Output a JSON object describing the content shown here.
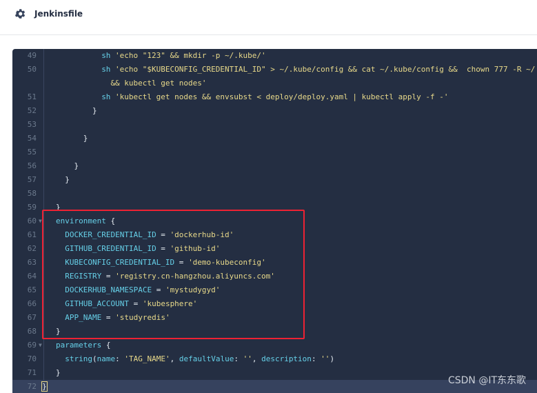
{
  "header": {
    "title": "Jenkinsfile",
    "icon": "gear-icon"
  },
  "colors": {
    "background": "#242e42",
    "keyword": "#66d0e8",
    "string": "#e8d98a",
    "highlight": "#ee2233"
  },
  "lines": [
    {
      "n": "49",
      "i": 10,
      "t": [
        [
          "k",
          "sh"
        ],
        [
          "s",
          " 'echo \"123\" && mkdir -p ~/.kube/'"
        ]
      ]
    },
    {
      "n": "50",
      "i": 10,
      "t": [
        [
          "k",
          "sh"
        ],
        [
          "s",
          " 'echo \"$KUBECONFIG_CREDENTIAL_ID\" > ~/.kube/config && cat ~/.kube/config &&  chown 777 -R ~/."
        ]
      ]
    },
    {
      "n": "",
      "i": 12,
      "t": [
        [
          "s",
          "&& kubectl get nodes'"
        ]
      ]
    },
    {
      "n": "51",
      "i": 10,
      "t": [
        [
          "k",
          "sh"
        ],
        [
          "s",
          " 'kubectl get nodes && envsubst < deploy/deploy.yaml | kubectl apply -f -'"
        ]
      ]
    },
    {
      "n": "52",
      "i": 8,
      "t": [
        [
          "p",
          "}"
        ]
      ]
    },
    {
      "n": "53",
      "i": 0,
      "t": []
    },
    {
      "n": "54",
      "i": 6,
      "t": [
        [
          "p",
          "}"
        ]
      ]
    },
    {
      "n": "55",
      "i": 0,
      "t": []
    },
    {
      "n": "56",
      "i": 4,
      "t": [
        [
          "p",
          "}"
        ]
      ]
    },
    {
      "n": "57",
      "i": 2,
      "t": [
        [
          "p",
          "}"
        ]
      ]
    },
    {
      "n": "58",
      "i": 0,
      "t": []
    },
    {
      "n": "59",
      "i": 0,
      "t": [
        [
          "p",
          "}"
        ]
      ]
    },
    {
      "n": "60",
      "i": 0,
      "f": true,
      "t": [
        [
          "k",
          "environment"
        ],
        [
          "p",
          " {"
        ]
      ]
    },
    {
      "n": "61",
      "i": 2,
      "t": [
        [
          "k",
          "DOCKER_CREDENTIAL_ID"
        ],
        [
          "p",
          " = "
        ],
        [
          "s",
          "'dockerhub-id'"
        ]
      ]
    },
    {
      "n": "62",
      "i": 2,
      "t": [
        [
          "k",
          "GITHUB_CREDENTIAL_ID"
        ],
        [
          "p",
          " = "
        ],
        [
          "s",
          "'github-id'"
        ]
      ]
    },
    {
      "n": "63",
      "i": 2,
      "t": [
        [
          "k",
          "KUBECONFIG_CREDENTIAL_ID"
        ],
        [
          "p",
          " = "
        ],
        [
          "s",
          "'demo-kubeconfig'"
        ]
      ]
    },
    {
      "n": "64",
      "i": 2,
      "t": [
        [
          "k",
          "REGISTRY"
        ],
        [
          "p",
          " = "
        ],
        [
          "s",
          "'registry.cn-hangzhou.aliyuncs.com'"
        ]
      ]
    },
    {
      "n": "65",
      "i": 2,
      "t": [
        [
          "k",
          "DOCKERHUB_NAMESPACE"
        ],
        [
          "p",
          " = "
        ],
        [
          "s",
          "'mystudygyd'"
        ]
      ]
    },
    {
      "n": "66",
      "i": 2,
      "t": [
        [
          "k",
          "GITHUB_ACCOUNT"
        ],
        [
          "p",
          " = "
        ],
        [
          "s",
          "'kubesphere'"
        ]
      ]
    },
    {
      "n": "67",
      "i": 2,
      "t": [
        [
          "k",
          "APP_NAME"
        ],
        [
          "p",
          " = "
        ],
        [
          "s",
          "'studyredis'"
        ]
      ]
    },
    {
      "n": "68",
      "i": 0,
      "t": [
        [
          "p",
          "}"
        ]
      ]
    },
    {
      "n": "69",
      "i": 0,
      "f": true,
      "t": [
        [
          "k",
          "parameters"
        ],
        [
          "p",
          " {"
        ]
      ]
    },
    {
      "n": "70",
      "i": 2,
      "t": [
        [
          "k",
          "string"
        ],
        [
          "p",
          "("
        ],
        [
          "k",
          "name"
        ],
        [
          "p",
          ": "
        ],
        [
          "s",
          "'TAG_NAME'"
        ],
        [
          "p",
          ", "
        ],
        [
          "k",
          "defaultValue"
        ],
        [
          "p",
          ": "
        ],
        [
          "s",
          "''"
        ],
        [
          "p",
          ", "
        ],
        [
          "k",
          "description"
        ],
        [
          "p",
          ": "
        ],
        [
          "s",
          "''"
        ],
        [
          "p",
          ")"
        ]
      ]
    },
    {
      "n": "71",
      "i": 0,
      "t": [
        [
          "p",
          "}"
        ]
      ]
    },
    {
      "n": "72",
      "i": -3,
      "cur": true,
      "t": [
        [
          "p",
          "}"
        ]
      ]
    }
  ],
  "watermark": "CSDN @IT东东歌"
}
